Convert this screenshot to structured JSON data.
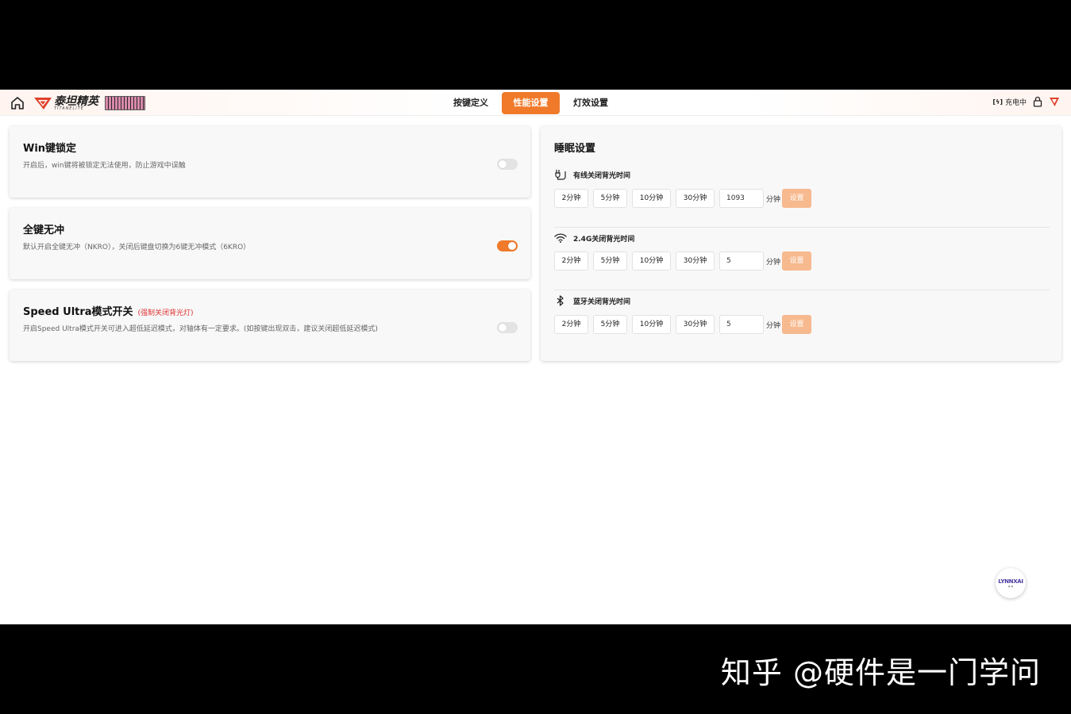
{
  "nav": {
    "logo_cn": "泰坦精英",
    "logo_en": "TITANELITE",
    "tabs": [
      {
        "label": "按键定义",
        "active": false
      },
      {
        "label": "性能设置",
        "active": true
      },
      {
        "label": "灯效设置",
        "active": false
      }
    ],
    "status": {
      "battery_icon": "battery-charging-icon",
      "battery_text": "充电中"
    }
  },
  "settings": {
    "win_lock": {
      "title": "Win键锁定",
      "desc": "开启后，win键将被锁定无法使用，防止游戏中误触",
      "enabled": false
    },
    "nkro": {
      "title": "全键无冲",
      "desc": "默认开启全键无冲（NKRO），关闭后键盘切换为6键无冲模式（6KRO）",
      "enabled": true
    },
    "speed_ultra": {
      "title": "Speed Ultra模式开关",
      "note": "(强制关闭背光灯)",
      "desc": "开启Speed Ultra模式开关可进入超低延迟模式，对轴体有一定要求。(如按键出现双击，建议关闭超低延迟模式)",
      "enabled": false
    }
  },
  "sleep": {
    "title": "睡眠设置",
    "options": [
      "2分钟",
      "5分钟",
      "10分钟",
      "30分钟"
    ],
    "unit": "分钟",
    "set_label": "设置",
    "rows": [
      {
        "icon": "cable-icon",
        "label": "有线关闭背光时间",
        "value": "1093"
      },
      {
        "icon": "wifi-icon",
        "label": "2.4G关闭背光时间",
        "value": "5"
      },
      {
        "icon": "bluetooth-icon",
        "label": "蓝牙关闭背光时间",
        "value": "5"
      }
    ]
  },
  "assistant": {
    "label": "LYNNXAI"
  },
  "watermark": "知乎 @硬件是一门学问",
  "colors": {
    "accent": "#f07a2a",
    "set_button": "#f7b98e",
    "note_red": "#e03030"
  }
}
